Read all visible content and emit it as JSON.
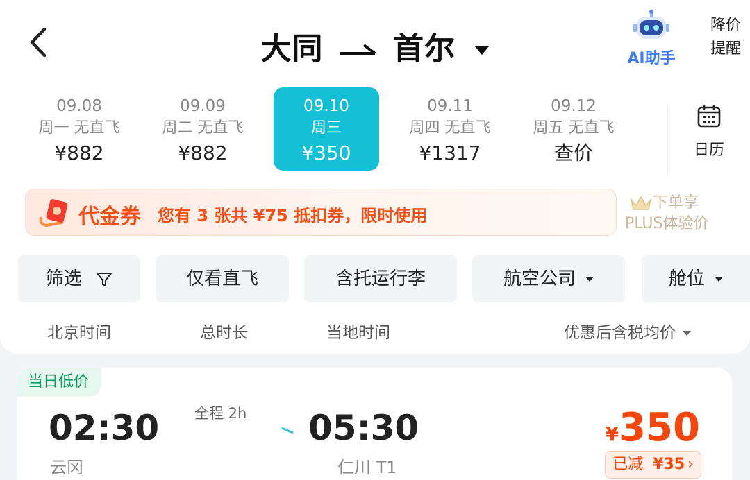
{
  "header": {
    "from": "大同",
    "to": "首尔",
    "ai_label": "AI助手",
    "price_alert_line1": "降价",
    "price_alert_line2": "提醒"
  },
  "dates": [
    {
      "date": "09.08",
      "weekday": "周一 无直飞",
      "price": "¥882",
      "selected": false
    },
    {
      "date": "09.09",
      "weekday": "周二 无直飞",
      "price": "¥882",
      "selected": false
    },
    {
      "date": "09.10",
      "weekday": "周三",
      "price": "¥350",
      "selected": true
    },
    {
      "date": "09.11",
      "weekday": "周四 无直飞",
      "price": "¥1317",
      "selected": false
    },
    {
      "date": "09.12",
      "weekday": "周五 无直飞",
      "price": "查价",
      "selected": false
    }
  ],
  "calendar_label": "日历",
  "coupon": {
    "title": "代金券",
    "text": "您有 3 张共 ¥75 抵扣券，限时使用"
  },
  "plus": {
    "line1": "下单享",
    "line2": "PLUS体验价"
  },
  "filters": {
    "filter": "筛选",
    "direct_only": "仅看直飞",
    "with_luggage": "含托运行李",
    "airline": "航空公司",
    "cabin": "舱位"
  },
  "sort": {
    "beijing_time": "北京时间",
    "duration": "总时长",
    "local_time": "当地时间",
    "price": "优惠后含税均价"
  },
  "flight": {
    "badge": "当日低价",
    "dep_time": "02:30",
    "dep_airport": "云冈",
    "duration": "全程 2h",
    "arr_time": "05:30",
    "arr_airport": "仁川 T1",
    "currency": "¥",
    "price": "350",
    "saved_label": "已减",
    "saved_value": "¥35",
    "chevron": "›"
  },
  "colors": {
    "accent": "#14c0d6",
    "price": "#f5470d",
    "coupon": "#f25016",
    "badge_text": "#0a9a5f"
  }
}
